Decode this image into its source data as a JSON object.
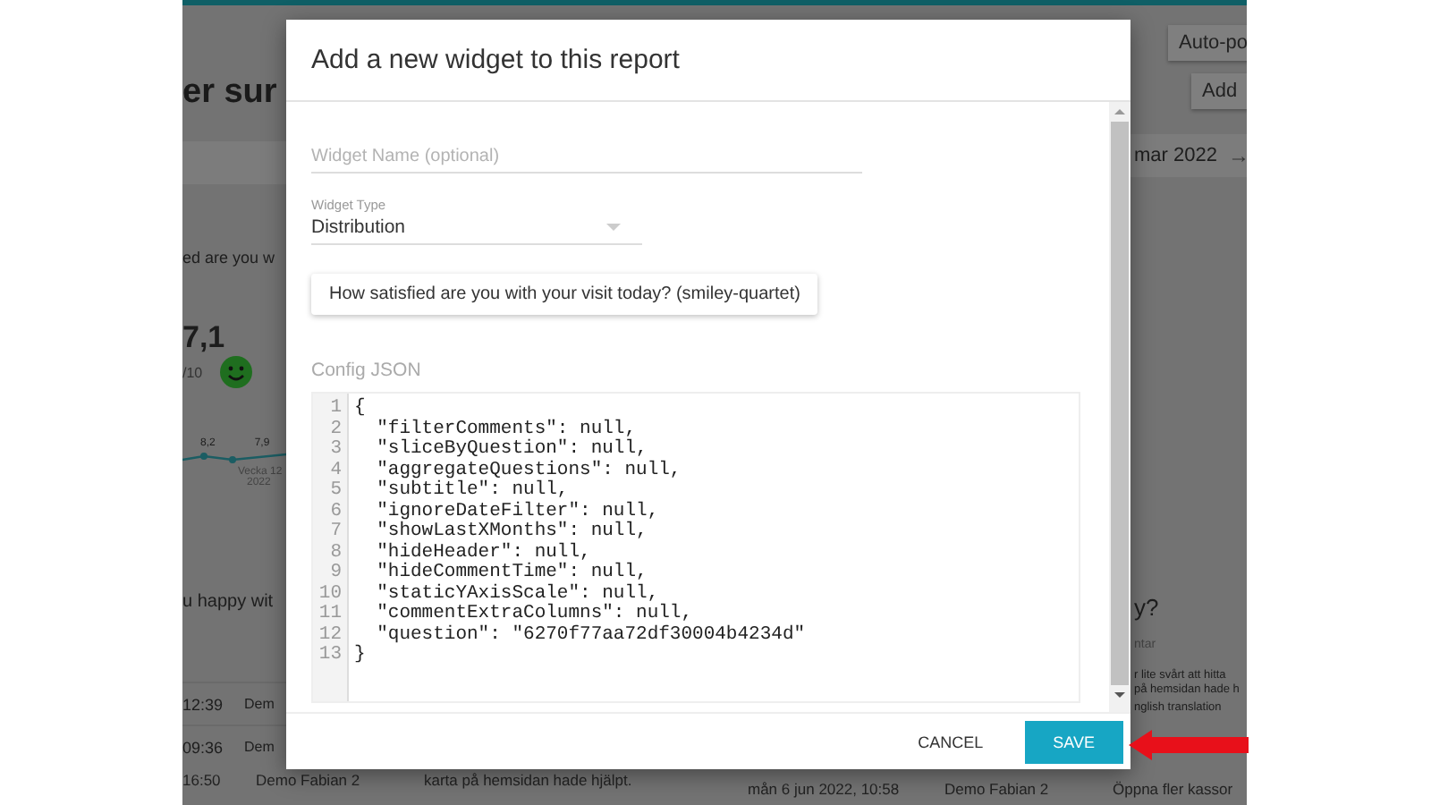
{
  "background": {
    "title": "er sur",
    "buttons": [
      "Auto-po",
      "Add"
    ],
    "date_range": "mar 2022",
    "next_arrow": "→",
    "score_card": {
      "title": "ed are you w",
      "score": "7,1",
      "score_max": "/10",
      "chart_labels": [
        "8,2",
        "7,9"
      ],
      "week_label": "Vecka 12",
      "year_label": "2022"
    },
    "comments_card": {
      "title": "u happy wit",
      "rows": [
        {
          "time": "12:39",
          "name": "Dem"
        },
        {
          "time": "09:36",
          "name": "Dem"
        }
      ]
    },
    "right_card": {
      "title": "y?",
      "column": "ntar",
      "lines": [
        "r lite svårt att hitta",
        "på hemsidan hade h",
        "nglish translation"
      ]
    },
    "bottom_row": [
      "16:50",
      "Demo Fabian 2",
      "karta på hemsidan hade hjälpt.",
      "mån 6 jun 2022, 10:58",
      "Demo Fabian 2",
      "Öppna fler kassor"
    ]
  },
  "dialog": {
    "title": "Add a new widget to this report",
    "name_field": {
      "placeholder": "Widget Name (optional)"
    },
    "type_field": {
      "label": "Widget Type",
      "value": "Distribution"
    },
    "question_chip": "How satisfied are you with your visit today? (smiley-quartet)",
    "config_label": "Config JSON",
    "code_lines": [
      {
        "number": "1",
        "code": "{"
      },
      {
        "number": "2",
        "code": "  \"filterComments\": null,"
      },
      {
        "number": "3",
        "code": "  \"sliceByQuestion\": null,"
      },
      {
        "number": "4",
        "code": "  \"aggregateQuestions\": null,"
      },
      {
        "number": "5",
        "code": "  \"subtitle\": null,"
      },
      {
        "number": "6",
        "code": "  \"ignoreDateFilter\": null,"
      },
      {
        "number": "7",
        "code": "  \"showLastXMonths\": null,"
      },
      {
        "number": "8",
        "code": "  \"hideHeader\": null,"
      },
      {
        "number": "9",
        "code": "  \"hideCommentTime\": null,"
      },
      {
        "number": "10",
        "code": "  \"staticYAxisScale\": null,"
      },
      {
        "number": "11",
        "code": "  \"commentExtraColumns\": null,"
      },
      {
        "number": "12",
        "code": "  \"question\": \"6270f77aa72df30004b4234d\""
      },
      {
        "number": "13",
        "code": "}"
      }
    ],
    "buttons": [
      {
        "label": "CANCEL",
        "kind": "text"
      },
      {
        "label": "SAVE",
        "kind": "primary"
      }
    ]
  }
}
